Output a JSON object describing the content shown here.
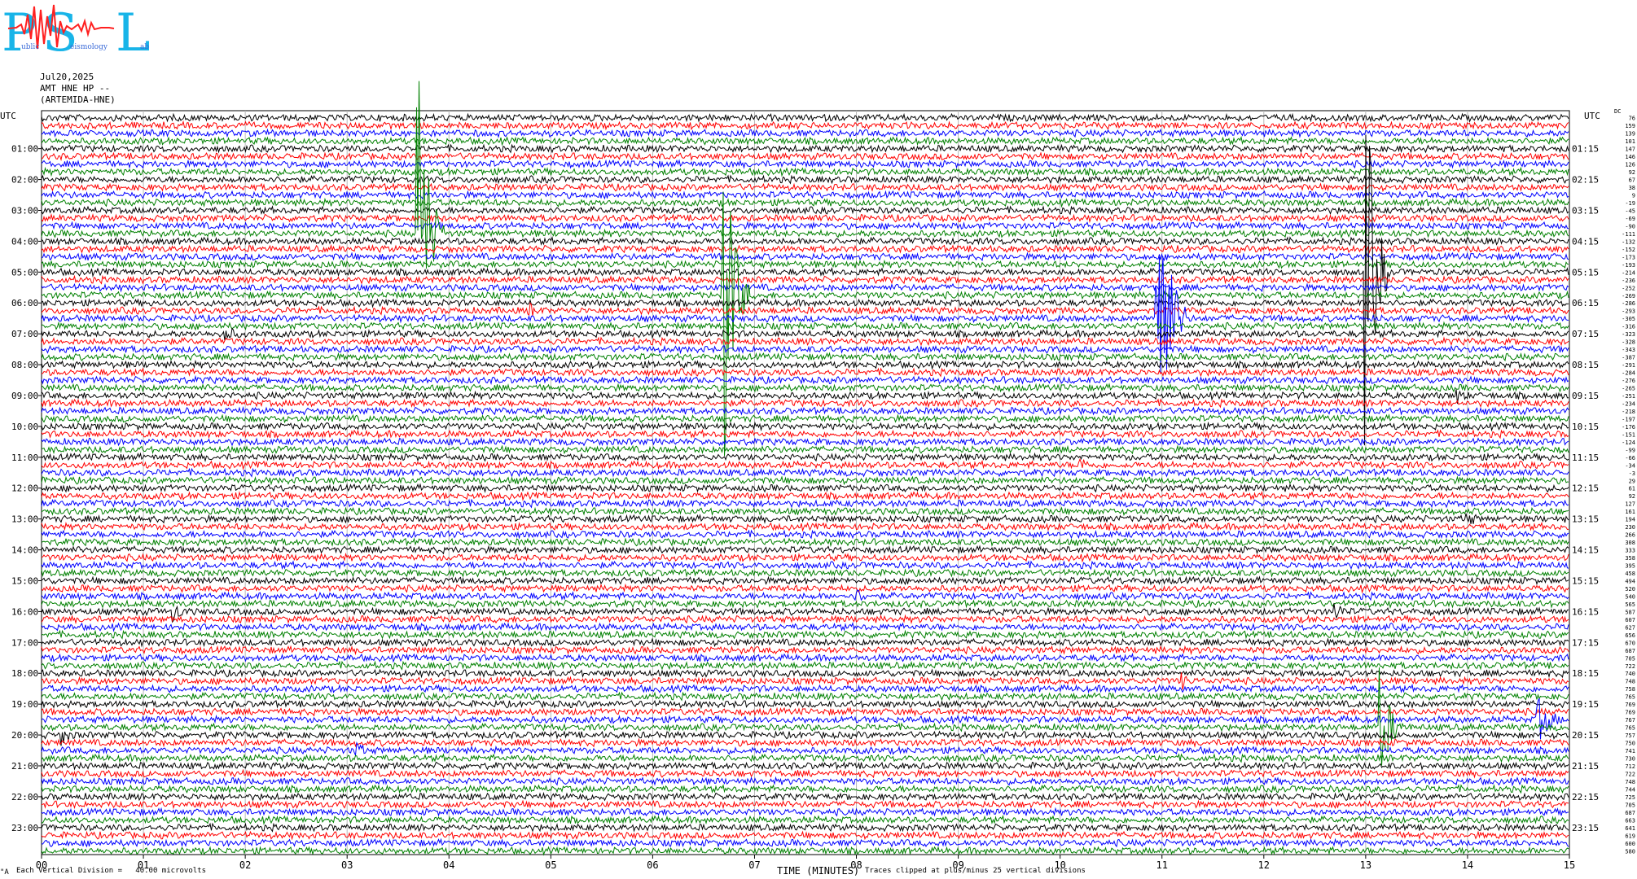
{
  "logo": {
    "letters": [
      "P",
      "S",
      "L"
    ],
    "words": [
      "ublic",
      "eismology",
      "ab"
    ],
    "colors": {
      "letters": "#18b4e8",
      "wave": "#ff2020",
      "small": "#3b6bd8"
    }
  },
  "header": {
    "date": "Jul20,2025",
    "station": "AMT HNE HP --",
    "name": "(ARTEMIDA-HNE)"
  },
  "axis": {
    "utc_label": "UTC",
    "left_times": [
      "01:00",
      "02:00",
      "03:00",
      "04:00",
      "05:00",
      "06:00",
      "07:00",
      "08:00",
      "09:00",
      "10:00",
      "11:00",
      "12:00",
      "13:00",
      "14:00",
      "15:00",
      "16:00",
      "17:00",
      "18:00",
      "19:00",
      "20:00",
      "21:00",
      "22:00",
      "23:00"
    ],
    "right_times": [
      "01:15",
      "02:15",
      "03:15",
      "04:15",
      "05:15",
      "06:15",
      "07:15",
      "08:15",
      "09:15",
      "10:15",
      "11:15",
      "12:15",
      "13:15",
      "14:15",
      "15:15",
      "16:15",
      "17:15",
      "18:15",
      "19:15",
      "20:15",
      "21:15",
      "22:15",
      "23:15"
    ],
    "x_ticks": [
      "00",
      "01",
      "02",
      "03",
      "04",
      "05",
      "06",
      "07",
      "08",
      "09",
      "10",
      "11",
      "12",
      "13",
      "14",
      "15"
    ],
    "xlabel": "TIME (MINUTES)"
  },
  "footer": {
    "scale_text": "Each Vertical Division =   40.00 microvolts",
    "clip_text": "Traces clipped at plus/minus 25 vertical divisions",
    "corner": "\"A"
  },
  "right_col_header": "DC",
  "chart_data": {
    "type": "line",
    "title": "",
    "xlabel": "TIME (MINUTES)",
    "ylabel": "UTC",
    "xlim": [
      0,
      15
    ],
    "traces_count": 96,
    "minutes_per_trace": 15,
    "trace_color_cycle": [
      "#000000",
      "#ff0000",
      "#0000ff",
      "#008000"
    ],
    "dc_offsets": [
      76,
      159,
      139,
      101,
      147,
      146,
      126,
      92,
      67,
      38,
      9,
      -19,
      -45,
      -69,
      -90,
      -111,
      -132,
      -152,
      -173,
      -193,
      -214,
      -236,
      -252,
      -269,
      -286,
      -293,
      -305,
      -316,
      -323,
      -328,
      -343,
      -387,
      -291,
      -284,
      -276,
      -265,
      -251,
      -234,
      -218,
      -197,
      -176,
      -151,
      -124,
      -99,
      -66,
      -34,
      -3,
      29,
      61,
      92,
      127,
      161,
      194,
      230,
      266,
      308,
      333,
      358,
      395,
      458,
      494,
      520,
      540,
      565,
      587,
      607,
      627,
      656,
      670,
      687,
      705,
      722,
      740,
      748,
      758,
      765,
      769,
      769,
      767,
      765,
      757,
      750,
      741,
      730,
      712,
      722,
      748,
      744,
      725,
      705,
      687,
      663,
      641,
      619,
      600,
      580
    ],
    "events": [
      {
        "start_min": 3.7,
        "trace": 15,
        "amp_div": 25,
        "duration_min": 0.25
      },
      {
        "start_min": 6.7,
        "trace": 23,
        "amp_div": 25,
        "duration_min": 0.25
      },
      {
        "start_min": 10.95,
        "trace": 26,
        "amp_div": 25,
        "duration_min": 0.3
      },
      {
        "start_min": 13.0,
        "trace": 20,
        "amp_div": 25,
        "duration_min": 0.25
      },
      {
        "start_min": 13.15,
        "trace": 79,
        "amp_div": 8,
        "duration_min": 0.25
      },
      {
        "start_min": 14.7,
        "trace": 78,
        "amp_div": 3,
        "duration_min": 0.35
      },
      {
        "start_min": 1.3,
        "trace": 64,
        "amp_div": 1.5,
        "duration_min": 0.3
      },
      {
        "start_min": 12.7,
        "trace": 64,
        "amp_div": 1.5,
        "duration_min": 0.3
      },
      {
        "start_min": 0.2,
        "trace": 80,
        "amp_div": 1.5,
        "duration_min": 0.3
      },
      {
        "start_min": 1.8,
        "trace": 28,
        "amp_div": 1.2,
        "duration_min": 0.4
      },
      {
        "start_min": 4.8,
        "trace": 25,
        "amp_div": 1.2,
        "duration_min": 0.3
      },
      {
        "start_min": 8.0,
        "trace": 62,
        "amp_div": 1.2,
        "duration_min": 0.3
      },
      {
        "start_min": 3.1,
        "trace": 82,
        "amp_div": 1.2,
        "duration_min": 0.3
      },
      {
        "start_min": 14.0,
        "trace": 52,
        "amp_div": 1.2,
        "duration_min": 0.3
      },
      {
        "start_min": 13.9,
        "trace": 36,
        "amp_div": 1.2,
        "duration_min": 0.3
      },
      {
        "start_min": 10.2,
        "trace": 45,
        "amp_div": 1.2,
        "duration_min": 0.3
      },
      {
        "start_min": 11.2,
        "trace": 73,
        "amp_div": 1.2,
        "duration_min": 0.2
      }
    ]
  }
}
